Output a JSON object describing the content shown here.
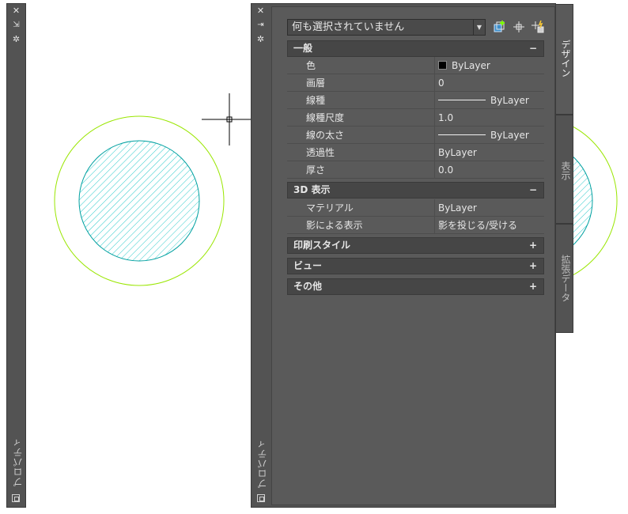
{
  "left_palette": {
    "title": "プロパティ",
    "close_glyph": "✕",
    "autohide_glyph": "⇲",
    "settings_glyph": "✲"
  },
  "palette": {
    "title": "プロパティ",
    "close_glyph": "✕",
    "autohide_glyph": "⇥",
    "settings_glyph": "✲",
    "selection": "何も選択されていません",
    "tabs": [
      "デザイン",
      "表示",
      "拡張データ"
    ],
    "sections": [
      {
        "title": "一般",
        "toggle": "−",
        "rows": [
          {
            "name": "色",
            "value": "ByLayer",
            "kind": "color"
          },
          {
            "name": "画層",
            "value": "0",
            "kind": "text"
          },
          {
            "name": "線種",
            "value": "ByLayer",
            "kind": "line"
          },
          {
            "name": "線種尺度",
            "value": "1.0",
            "kind": "text"
          },
          {
            "name": "線の太さ",
            "value": "ByLayer",
            "kind": "line"
          },
          {
            "name": "透過性",
            "value": "ByLayer",
            "kind": "text"
          },
          {
            "name": "厚さ",
            "value": "0.0",
            "kind": "text"
          }
        ]
      },
      {
        "title": "3D 表示",
        "toggle": "−",
        "rows": [
          {
            "name": "マテリアル",
            "value": "ByLayer",
            "kind": "text"
          },
          {
            "name": "影による表示",
            "value": "影を投じる/受ける",
            "kind": "text"
          }
        ]
      },
      {
        "title": "印刷スタイル",
        "toggle": "+",
        "rows": []
      },
      {
        "title": "ビュー",
        "toggle": "+",
        "rows": []
      },
      {
        "title": "その他",
        "toggle": "+",
        "rows": []
      }
    ]
  },
  "icons": {
    "quick_select": "quick-select-icon",
    "select_objects": "select-objects-icon",
    "pickadd": "pickadd-toggle-icon"
  },
  "colors": {
    "outer_circle": "#99e600",
    "hatch": "#33cccc",
    "inner_circle": "#00a0a0",
    "panel": "#5a5a5a"
  }
}
